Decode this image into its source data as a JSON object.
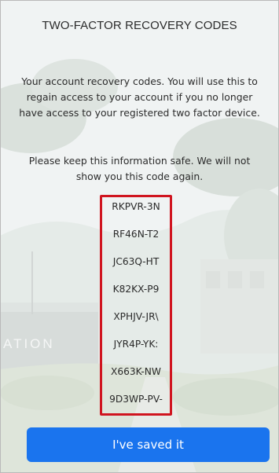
{
  "dialog": {
    "title": "TWO-FACTOR RECOVERY CODES",
    "description": "Your account recovery codes. You will use this to regain access to your account if you no longer have access to your registered two factor device.",
    "warning": "Please keep this information safe. We will not show you this code again.",
    "codes": [
      "RKPVR-3N",
      "RF46N-T2",
      "JC63Q-HT",
      "K82KX-P9",
      "XPHJV-JR\\",
      "JYR4P-YK:",
      "X663K-NW",
      "9D3WP-PV-"
    ],
    "save_label": "I've saved it",
    "background_text": "ATION"
  },
  "colors": {
    "button": "#1a74ee",
    "highlight_border": "#d0141f"
  }
}
